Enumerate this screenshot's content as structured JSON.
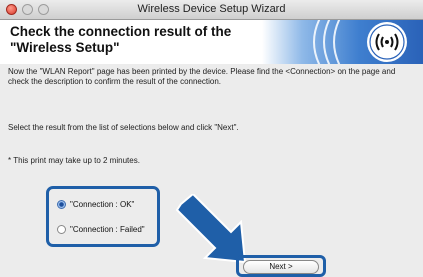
{
  "window": {
    "title": "Wireless Device Setup Wizard"
  },
  "banner": {
    "heading": "Check the connection result of the \"Wireless Setup\""
  },
  "body": {
    "intro": "Now the \"WLAN Report\" page has been printed by the device. Please find the <Connection> on the page and check the description to confirm the result of the connection.",
    "instruction": "Select the result from the list of selections below and click \"Next\".",
    "note": "* This print may take up to 2 minutes."
  },
  "options": {
    "items": [
      {
        "label": "\"Connection : OK\"",
        "selected": true
      },
      {
        "label": "\"Connection : Failed\"",
        "selected": false
      }
    ]
  },
  "buttons": {
    "next": "Next >"
  },
  "colors": {
    "accent": "#1f5fa8",
    "banner_blue": "#2a62b8"
  },
  "icons": {
    "banner": "wireless-signal-icon",
    "arrow": "pointer-arrow-icon"
  }
}
